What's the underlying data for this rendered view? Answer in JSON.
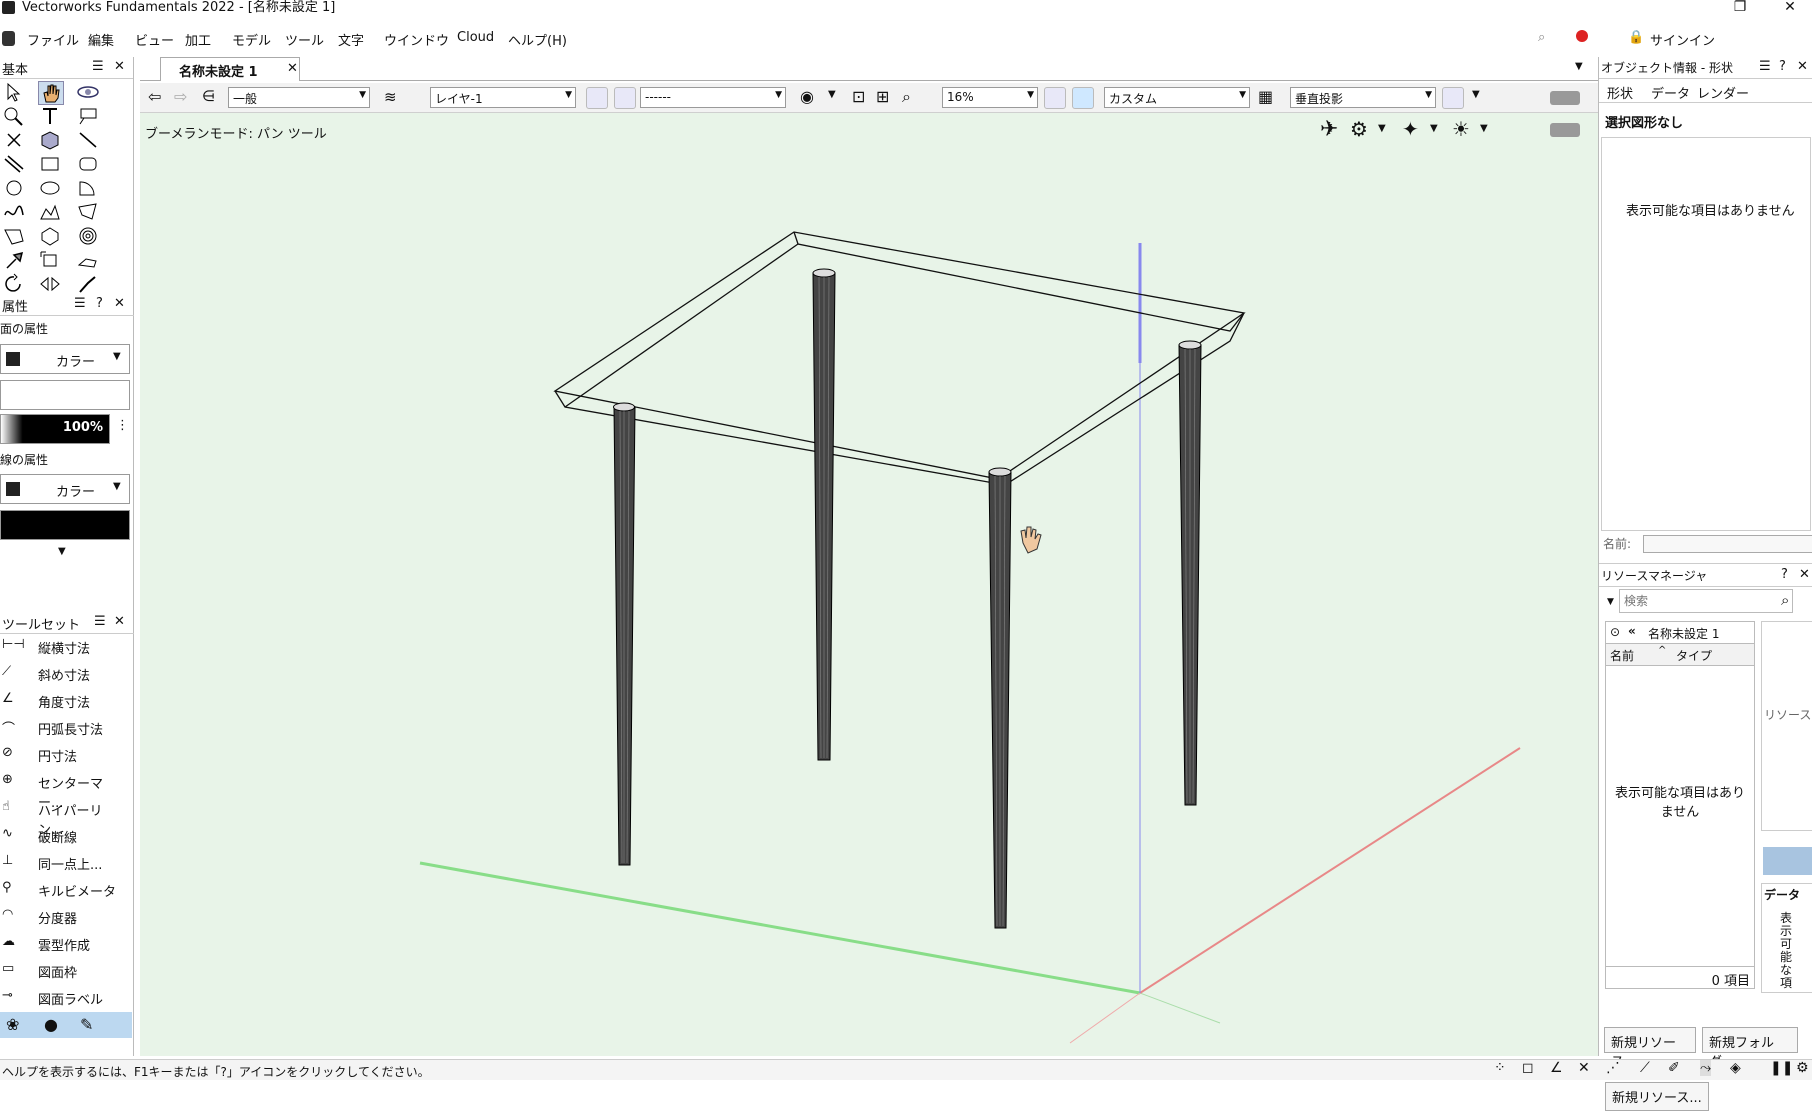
{
  "window": {
    "title": "Vectorworks Fundamentals 2022 - [名称未設定 1]"
  },
  "menubar": {
    "items": [
      "ファイル",
      "編集",
      "ビュー",
      "加工",
      "モデル",
      "ツール",
      "文字",
      "ウインドウ",
      "Cloud",
      "ヘルプ(H)"
    ],
    "signin_label": "サインイン"
  },
  "document_tab": {
    "label": "名称未設定 1"
  },
  "view_bar": {
    "class_value": "一般",
    "layer_value": "レイヤ-1",
    "line_value": "------",
    "zoom_value": "16%",
    "custom_value": "カスタム",
    "projection_value": "垂直投影"
  },
  "canvas": {
    "mode_text": "ブーメランモード: パン ツール"
  },
  "basic_palette": {
    "title": "基本"
  },
  "attributes": {
    "title": "属性",
    "fill_section": "面の属性",
    "fill_color_label": "カラー",
    "opacity_value": "100%",
    "line_section": "線の属性",
    "line_color_label": "カラー"
  },
  "toolset": {
    "title": "ツールセット",
    "items": [
      "縦横寸法",
      "斜め寸法",
      "角度寸法",
      "円弧長寸法",
      "円寸法",
      "センターマー...",
      "ハイパーリン...",
      "破断線",
      "同一点上...",
      "キルビメータ",
      "分度器",
      "雲型作成",
      "図面枠",
      "図面ラベル"
    ]
  },
  "obj_info": {
    "title": "オブジェクト情報 - 形状",
    "tabs": [
      "形状",
      "データ",
      "レンダー"
    ],
    "header": "選択図形なし",
    "empty_text": "表示可能な項目はありません",
    "name_label": "名前:"
  },
  "resource_manager": {
    "title": "リソースマネージャ",
    "search_placeholder": "検索",
    "file_label": "名称未設定 1",
    "columns": [
      "名前",
      "タイプ"
    ],
    "empty_text": "表示可能な項目はありません",
    "count_text": "0 項目",
    "new_resource_button": "新規リソース...",
    "new_folder_button": "新規フォルダ...",
    "side_label": "リソース",
    "side_data_label": "データ",
    "side_vertical_text": "表示可能な項"
  },
  "statusbar": {
    "help_text": "ヘルプを表示するには、F1キーまたは「?」アイコンをクリックしてください。"
  },
  "colors": {
    "canvas_bg": "#e8f4e8",
    "x_axis": "#e88888",
    "y_axis": "#88dd88",
    "z_axis": "#8888ee"
  }
}
